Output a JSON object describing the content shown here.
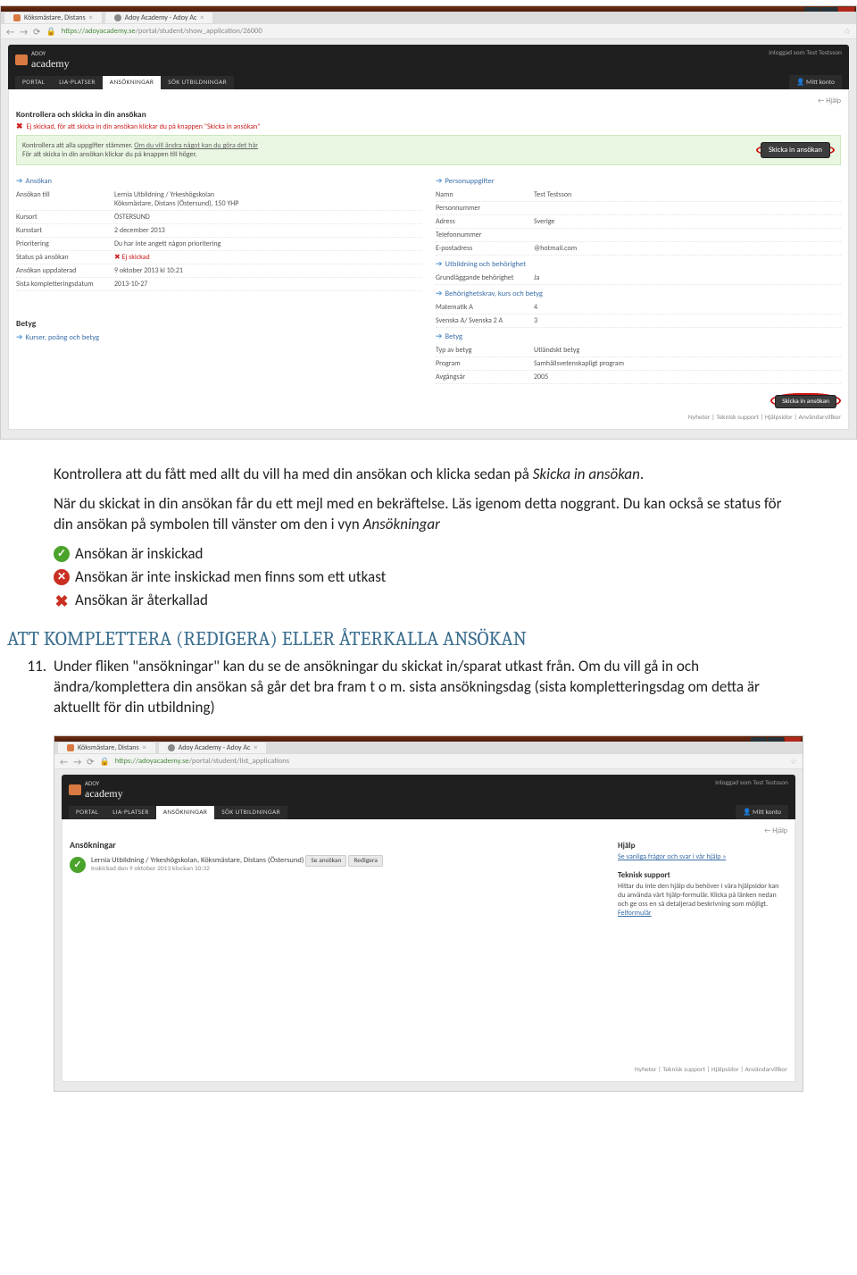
{
  "screenshot1": {
    "browser": {
      "tab1": "Köksmästare, Distans",
      "tab2": "Adoy Academy - Adoy Ac",
      "nav_back": "←",
      "nav_fwd": "→",
      "reload": "⟳",
      "lock": "🔒",
      "url_host": "https://adoyacademy.se",
      "url_path": "/portal/student/show_application/26000"
    },
    "header": {
      "brand_top": "ADOY",
      "brand_name": "academy",
      "logged_in": "Inloggad som Test Testsson",
      "nav": {
        "portal": "PORTAL",
        "lia": "LIA-PLATSER",
        "ans": "ANSÖKNINGAR",
        "sok": "SÖK UTBILDNINGAR"
      },
      "account": "👤 Mitt konto",
      "help": "← Hjälp"
    },
    "page": {
      "title": "Kontrollera och skicka in din ansökan",
      "alert": "Ej skickad, för att skicka in din ansökan klickar du på knappen \"Skicka in ansökan\"",
      "box_line1": "Kontrollera att alla uppgifter stämmer.",
      "box_link": "Om du vill ändra något kan du göra det här",
      "box_line2": "För att skicka in din ansökan klickar du på knappen till höger.",
      "submit_btn": "Skicka in ansökan",
      "sec_ansokan": "Ansökan",
      "rows_left": {
        "ansokan_till_l": "Ansökan till",
        "ansokan_till_v": "Lernia Utbildning / Yrkeshögskolan\nKöksmästare, Distans (Östersund), 150 YHP",
        "kursort_l": "Kursort",
        "kursort_v": "ÖSTERSUND",
        "kursstart_l": "Kursstart",
        "kursstart_v": "2 december 2013",
        "prio_l": "Prioritering",
        "prio_v": "Du har inte angett någon prioritering",
        "status_l": "Status på ansökan",
        "status_v": "✖ Ej skickad",
        "upd_l": "Ansökan uppdaterad",
        "upd_v": "9 oktober 2013 kl 10:21",
        "komp_l": "Sista kompletteringsdatum",
        "komp_v": "2013-10-27"
      },
      "sec_betyg": "Betyg",
      "betyg_link": "Kurser, poäng och betyg",
      "sec_person": "Personuppgifter",
      "rows_right": {
        "namn_l": "Namn",
        "namn_v": "Test Testsson",
        "pnr_l": "Personnummer",
        "pnr_v": "",
        "adr_l": "Adress",
        "adr_v": "Sverige",
        "tel_l": "Telefonnummer",
        "tel_v": "",
        "mail_l": "E-postadress",
        "mail_v": "@hotmail.com"
      },
      "sec_utb": "Utbildning och behörighet",
      "grund_l": "Grundläggande behörighet",
      "grund_v": "Ja",
      "beh_link": "Behörighetskrav, kurs och betyg",
      "mat_l": "Matematik A",
      "mat_v": "4",
      "sv_l": "Svenska A/ Svenska 2 A",
      "sv_v": "3",
      "sec_betyg2": "Betyg",
      "typ_l": "Typ av betyg",
      "typ_v": "Utländskt betyg",
      "prog_l": "Program",
      "prog_v": "Samhällsvetenskapligt program",
      "avg_l": "Avgångsår",
      "avg_v": "2005",
      "submit_btn2": "Skicka in ansökan",
      "footer": "Nyheter  |  Teknisk support  |  Hjälpsidor  |  Användarvillkor"
    }
  },
  "document": {
    "p1a": "Kontrollera att du fått med allt du vill ha med din ansökan och klicka sedan på ",
    "p1b": "Skicka in ansökan",
    "p1c": ".",
    "p2": "När du skickat in din ansökan får du ett mejl med en bekräftelse. Läs igenom detta noggrant. Du kan också se status för din ansökan på symbolen till vänster om den i vyn ",
    "p2b": "Ansökningar",
    "s_ok": "Ansökan är inskickad",
    "s_no": "Ansökan är inte inskickad men finns som ett utkast",
    "s_rec": "Ansökan är återkallad",
    "h2": "ATT KOMPLETTERA (REDIGERA) ELLER ÅTERKALLA ANSÖKAN",
    "li_n": "11.",
    "li_txt": "Under fliken \"ansökningar\" kan du se de ansökningar du skickat in/sparat utkast från. Om du vill gå in och ändra/komplettera din ansökan så går det bra fram t o m. sista ansökningsdag (sista kompletteringsdag om detta är aktuellt för din utbildning)"
  },
  "screenshot2": {
    "browser": {
      "tab1": "Köksmästare, Distans",
      "tab2": "Adoy Academy - Adoy Ac",
      "url_host": "https://adoyacademy.se",
      "url_path": "/portal/student/list_applications"
    },
    "title": "Ansökningar",
    "app": {
      "name": "Lernia Utbildning / Yrkeshögskolan, Köksmästare, Distans (Östersund)",
      "sub": "Inskickad den 9 oktober 2013 klockan 10:32",
      "btn_view": "Se ansökan",
      "btn_edit": "Redigera"
    },
    "side": {
      "h_help": "Hjälp",
      "help_link": "Se vanliga frågor och svar i vår hjälp »",
      "h_sup": "Teknisk support",
      "sup_txt": "Hittar du inte den hjälp du behöver i våra hjälpsidor kan du använda vårt hjälp-formulär. Klicka på länken nedan och ge oss en så detaljerad beskrivning som möjligt.",
      "sup_link": "Felformulär"
    },
    "footer": "Nyheter  |  Teknisk support  |  Hjälpsidor  |  Användarvillkor"
  }
}
